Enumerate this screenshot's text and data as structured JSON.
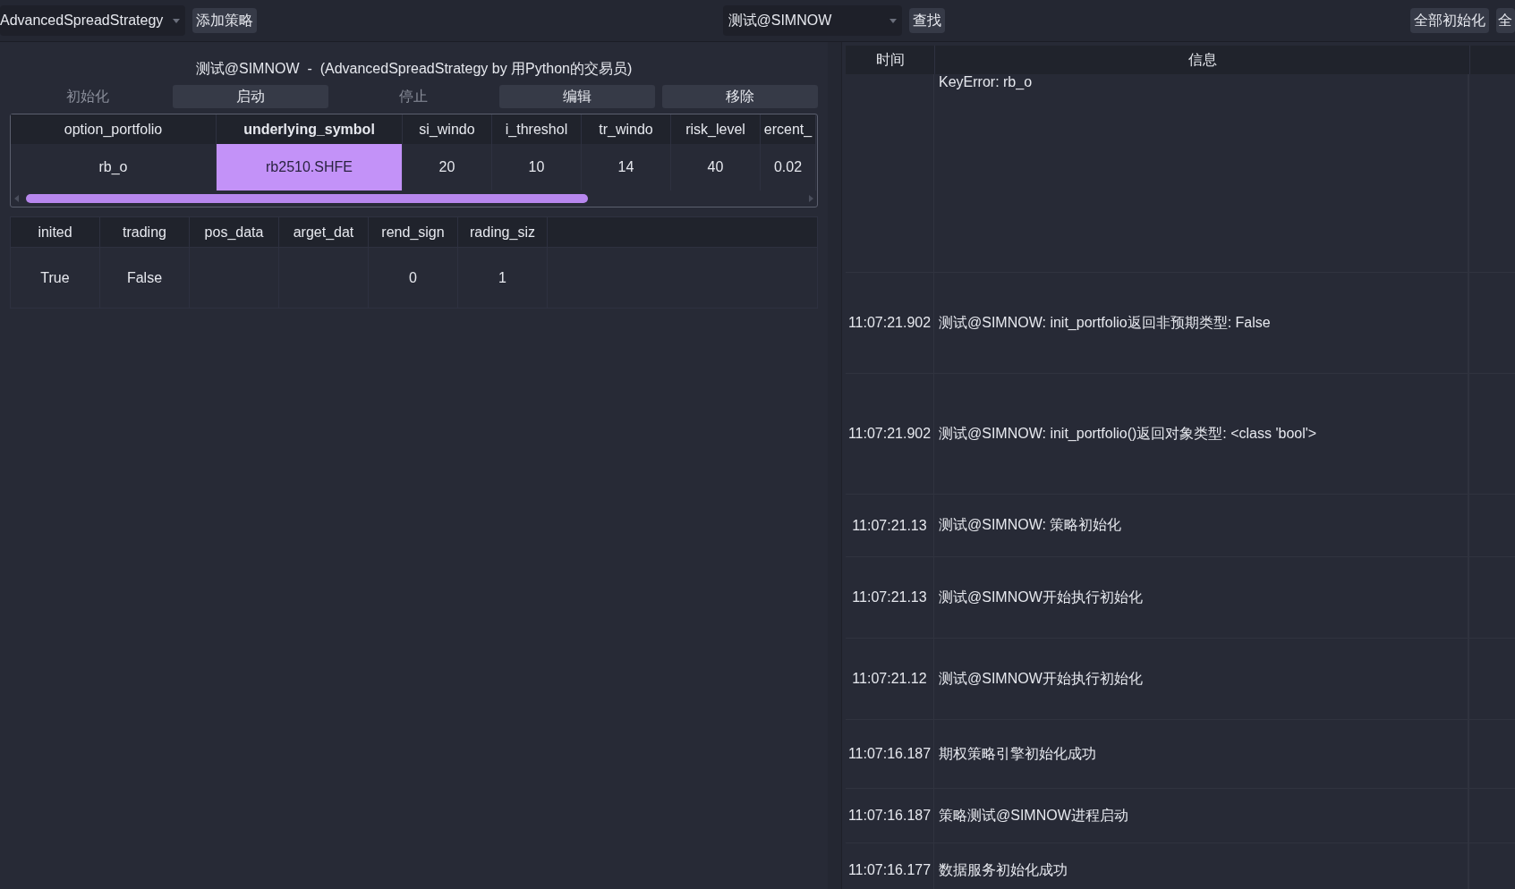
{
  "toolbar": {
    "strategy_select": "AdvancedSpreadStrategy",
    "add_button": "添加策略",
    "engine_select": "测试@SIMNOW",
    "find_button": "查找",
    "init_all_button": "全部初始化",
    "cut_button": "全"
  },
  "strategy": {
    "title": "测试@SIMNOW  -  (AdvancedSpreadStrategy by 用Python的交易员)",
    "buttons": [
      {
        "label": "初始化",
        "disabled": true
      },
      {
        "label": "启动",
        "disabled": false
      },
      {
        "label": "停止",
        "disabled": true
      },
      {
        "label": "编辑",
        "disabled": false
      },
      {
        "label": "移除",
        "disabled": false
      }
    ],
    "parameters": {
      "columns": [
        {
          "label": "option_portfolio",
          "selected": false
        },
        {
          "label": "underlying_symbol",
          "selected": true
        },
        {
          "label": "si_windo",
          "selected": false
        },
        {
          "label": "i_threshol",
          "selected": false
        },
        {
          "label": "tr_windo",
          "selected": false
        },
        {
          "label": "risk_level",
          "selected": false
        },
        {
          "label": "ercent_",
          "selected": false
        }
      ],
      "rows": [
        [
          {
            "text": "rb_o",
            "selected": false
          },
          {
            "text": "rb2510.SHFE",
            "selected": true
          },
          {
            "text": "20",
            "selected": false
          },
          {
            "text": "10",
            "selected": false
          },
          {
            "text": "14",
            "selected": false
          },
          {
            "text": "40",
            "selected": false
          },
          {
            "text": "0.02",
            "selected": false
          }
        ]
      ]
    },
    "variables": {
      "columns": [
        "inited",
        "trading",
        "pos_data",
        "arget_dat",
        "rend_sign",
        "rading_siz"
      ],
      "rows": [
        [
          "True",
          "False",
          null,
          null,
          "0",
          "1"
        ]
      ]
    }
  },
  "log": {
    "columns": [
      "时间",
      "信息"
    ],
    "rows": [
      {
        "message": "KeyError: rb_o"
      },
      {
        "time": "11:07:21.902",
        "message": "测试@SIMNOW: init_portfolio返回非预期类型: False"
      },
      {
        "time": "11:07:21.902",
        "message": "测试@SIMNOW: init_portfolio()返回对象类型: <class 'bool'>"
      },
      {
        "time": "11:07:21.13",
        "message": "测试@SIMNOW: 策略初始化"
      },
      {
        "time": "11:07:21.13",
        "message": "测试@SIMNOW开始执行初始化"
      },
      {
        "time": "11:07:21.12",
        "message": "测试@SIMNOW开始执行初始化"
      },
      {
        "time": "11:07:16.187",
        "message": "期权策略引擎初始化成功"
      },
      {
        "time": "11:07:16.187",
        "message": "策略测试@SIMNOW进程启动"
      },
      {
        "time": "11:07:16.177",
        "message": "数据服务初始化成功"
      }
    ]
  }
}
